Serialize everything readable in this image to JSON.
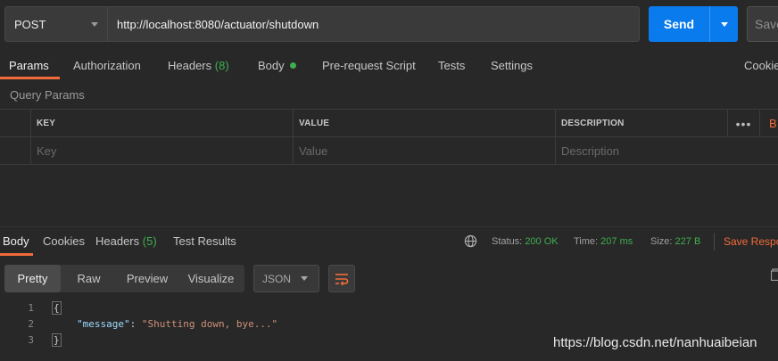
{
  "request": {
    "method": "POST",
    "url": "http://localhost:8080/actuator/shutdown",
    "send_label": "Send",
    "save_label": "Save"
  },
  "request_tabs": {
    "params": "Params",
    "authorization": "Authorization",
    "headers": "Headers",
    "headers_count": "(8)",
    "body": "Body",
    "pre_request": "Pre-request Script",
    "tests": "Tests",
    "settings": "Settings",
    "cookies": "Cookies"
  },
  "query_params": {
    "title": "Query Params",
    "columns": {
      "key": "KEY",
      "value": "VALUE",
      "description": "DESCRIPTION"
    },
    "more": "•••",
    "bulk_edit": "B",
    "placeholders": {
      "key": "Key",
      "value": "Value",
      "description": "Description"
    }
  },
  "response_tabs": {
    "body": "Body",
    "cookies": "Cookies",
    "headers": "Headers",
    "headers_count": "(5)",
    "test_results": "Test Results"
  },
  "response_meta": {
    "status_label": "Status:",
    "status_value": "200 OK",
    "time_label": "Time:",
    "time_value": "207 ms",
    "size_label": "Size:",
    "size_value": "227 B",
    "save_response": "Save Respo"
  },
  "view_modes": [
    "Pretty",
    "Raw",
    "Preview",
    "Visualize"
  ],
  "format": "JSON",
  "code": {
    "line_numbers": [
      "1",
      "2",
      "3"
    ],
    "open": "{",
    "key": "\"message\"",
    "colon": ": ",
    "value": "\"Shutting down, bye...\"",
    "close": "}"
  },
  "watermark": "https://blog.csdn.net/nanhuaibeian",
  "colors": {
    "accent": "#f26b3a",
    "send": "#097bed",
    "success": "#3fae50",
    "background": "#282828"
  }
}
